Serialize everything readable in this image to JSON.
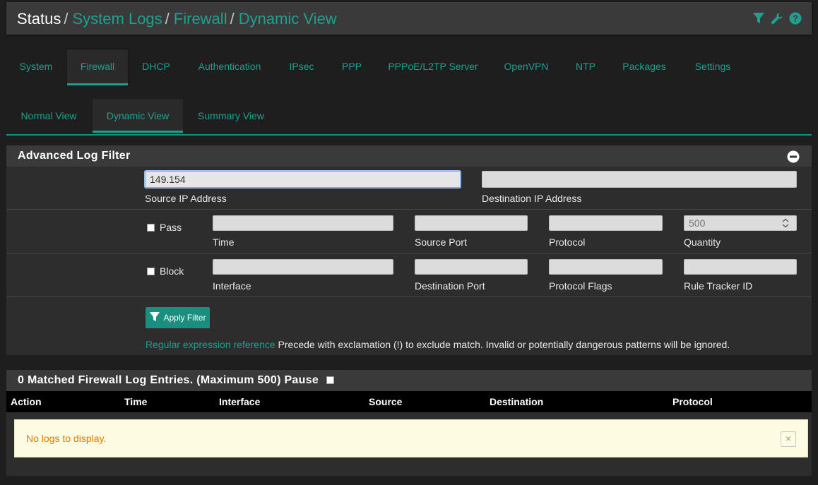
{
  "breadcrumb": {
    "status": "Status",
    "system_logs": "System Logs",
    "firewall": "Firewall",
    "dynamic_view": "Dynamic View",
    "separator": "/"
  },
  "header_icons": [
    "filter-icon",
    "wrench-icon",
    "help-icon"
  ],
  "main_tabs": [
    "System",
    "Firewall",
    "DHCP",
    "Authentication",
    "IPsec",
    "PPP",
    "PPPoE/L2TP Server",
    "OpenVPN",
    "NTP",
    "Packages",
    "Settings"
  ],
  "view_tabs": [
    "Normal View",
    "Dynamic View",
    "Summary View"
  ],
  "filter": {
    "title": "Advanced Log Filter",
    "source_ip_value": "149.154",
    "source_ip_label": "Source IP Address",
    "dest_ip_value": "",
    "dest_ip_label": "Destination IP Address",
    "pass_label": "Pass",
    "block_label": "Block",
    "time_label": "Time",
    "source_port_label": "Source Port",
    "protocol_label": "Protocol",
    "quantity_label": "Quantity",
    "quantity_placeholder": "500",
    "interface_label": "Interface",
    "dest_port_label": "Destination Port",
    "protocol_flags_label": "Protocol Flags",
    "rule_tracker_label": "Rule Tracker ID",
    "apply_label": "Apply Filter",
    "regex_link": "Regular expression reference",
    "hint_text": " Precede with exclamation (!) to exclude match. Invalid or potentially dangerous patterns will be ignored."
  },
  "results": {
    "title": "0 Matched Firewall Log Entries. (Maximum 500) Pause",
    "columns": [
      "Action",
      "Time",
      "Interface",
      "Source",
      "Destination",
      "Protocol"
    ],
    "empty_message": "No logs to display.",
    "close_glyph": "×"
  },
  "colors": {
    "accent": "#1fa08f",
    "alert_text": "#e07a00",
    "alert_bg": "#fdfbe0"
  }
}
